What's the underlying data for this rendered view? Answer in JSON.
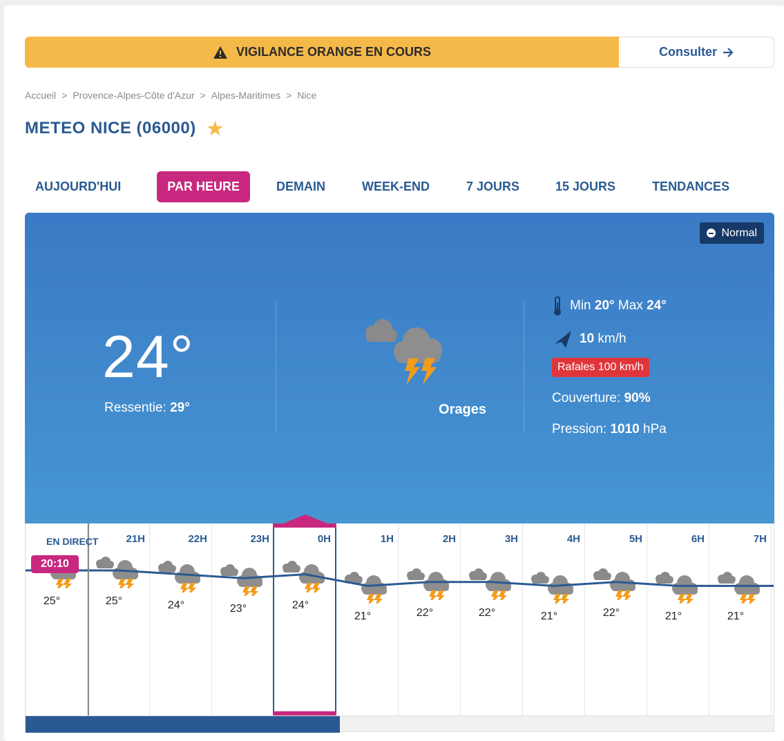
{
  "alert": {
    "text": "VIGILANCE ORANGE EN COURS",
    "button": "Consulter",
    "color": "#f5b94a"
  },
  "breadcrumb": [
    "Accueil",
    "Provence-Alpes-Côte d'Azur",
    "Alpes-Maritimes",
    "Nice"
  ],
  "page_title": "METEO NICE (06000)",
  "tabs": [
    {
      "label": "AUJOURD'HUI",
      "active": false
    },
    {
      "label": "PAR HEURE",
      "active": true
    },
    {
      "label": "DEMAIN",
      "active": false
    },
    {
      "label": "WEEK-END",
      "active": false
    },
    {
      "label": "7 JOURS",
      "active": false
    },
    {
      "label": "15 JOURS",
      "active": false
    },
    {
      "label": "TENDANCES",
      "active": false
    }
  ],
  "current": {
    "mode_button": "Normal",
    "temp": "24°",
    "feels_label": "Ressentie:",
    "feels_value": "29°",
    "condition": "Orages",
    "min_label": "Min",
    "min_value": "20°",
    "max_label": "Max",
    "max_value": "24°",
    "wind_value": "10",
    "wind_unit": "km/h",
    "gusts": "Rafales 100 km/h",
    "cover_label": "Couverture:",
    "cover_value": "90%",
    "pressure_label": "Pression:",
    "pressure_value": "1010",
    "pressure_unit": "hPa"
  },
  "hourly": {
    "live_label": "EN DIRECT",
    "live_time": "20:10",
    "hours": [
      {
        "hour": "",
        "temp": "25°"
      },
      {
        "hour": "21H",
        "temp": "25°"
      },
      {
        "hour": "22H",
        "temp": "24°"
      },
      {
        "hour": "23H",
        "temp": "23°"
      },
      {
        "hour": "0H",
        "temp": "24°"
      },
      {
        "hour": "1H",
        "temp": "21°"
      },
      {
        "hour": "2H",
        "temp": "22°"
      },
      {
        "hour": "3H",
        "temp": "22°"
      },
      {
        "hour": "4H",
        "temp": "21°"
      },
      {
        "hour": "5H",
        "temp": "22°"
      },
      {
        "hour": "6H",
        "temp": "21°"
      },
      {
        "hour": "7H",
        "temp": "21°"
      }
    ],
    "selected_index": 4,
    "scroll_fraction": 0.42
  },
  "colors": {
    "brand_blue": "#2a5a92",
    "accent_pink": "#c8287f",
    "gust_red": "#e0363b"
  }
}
